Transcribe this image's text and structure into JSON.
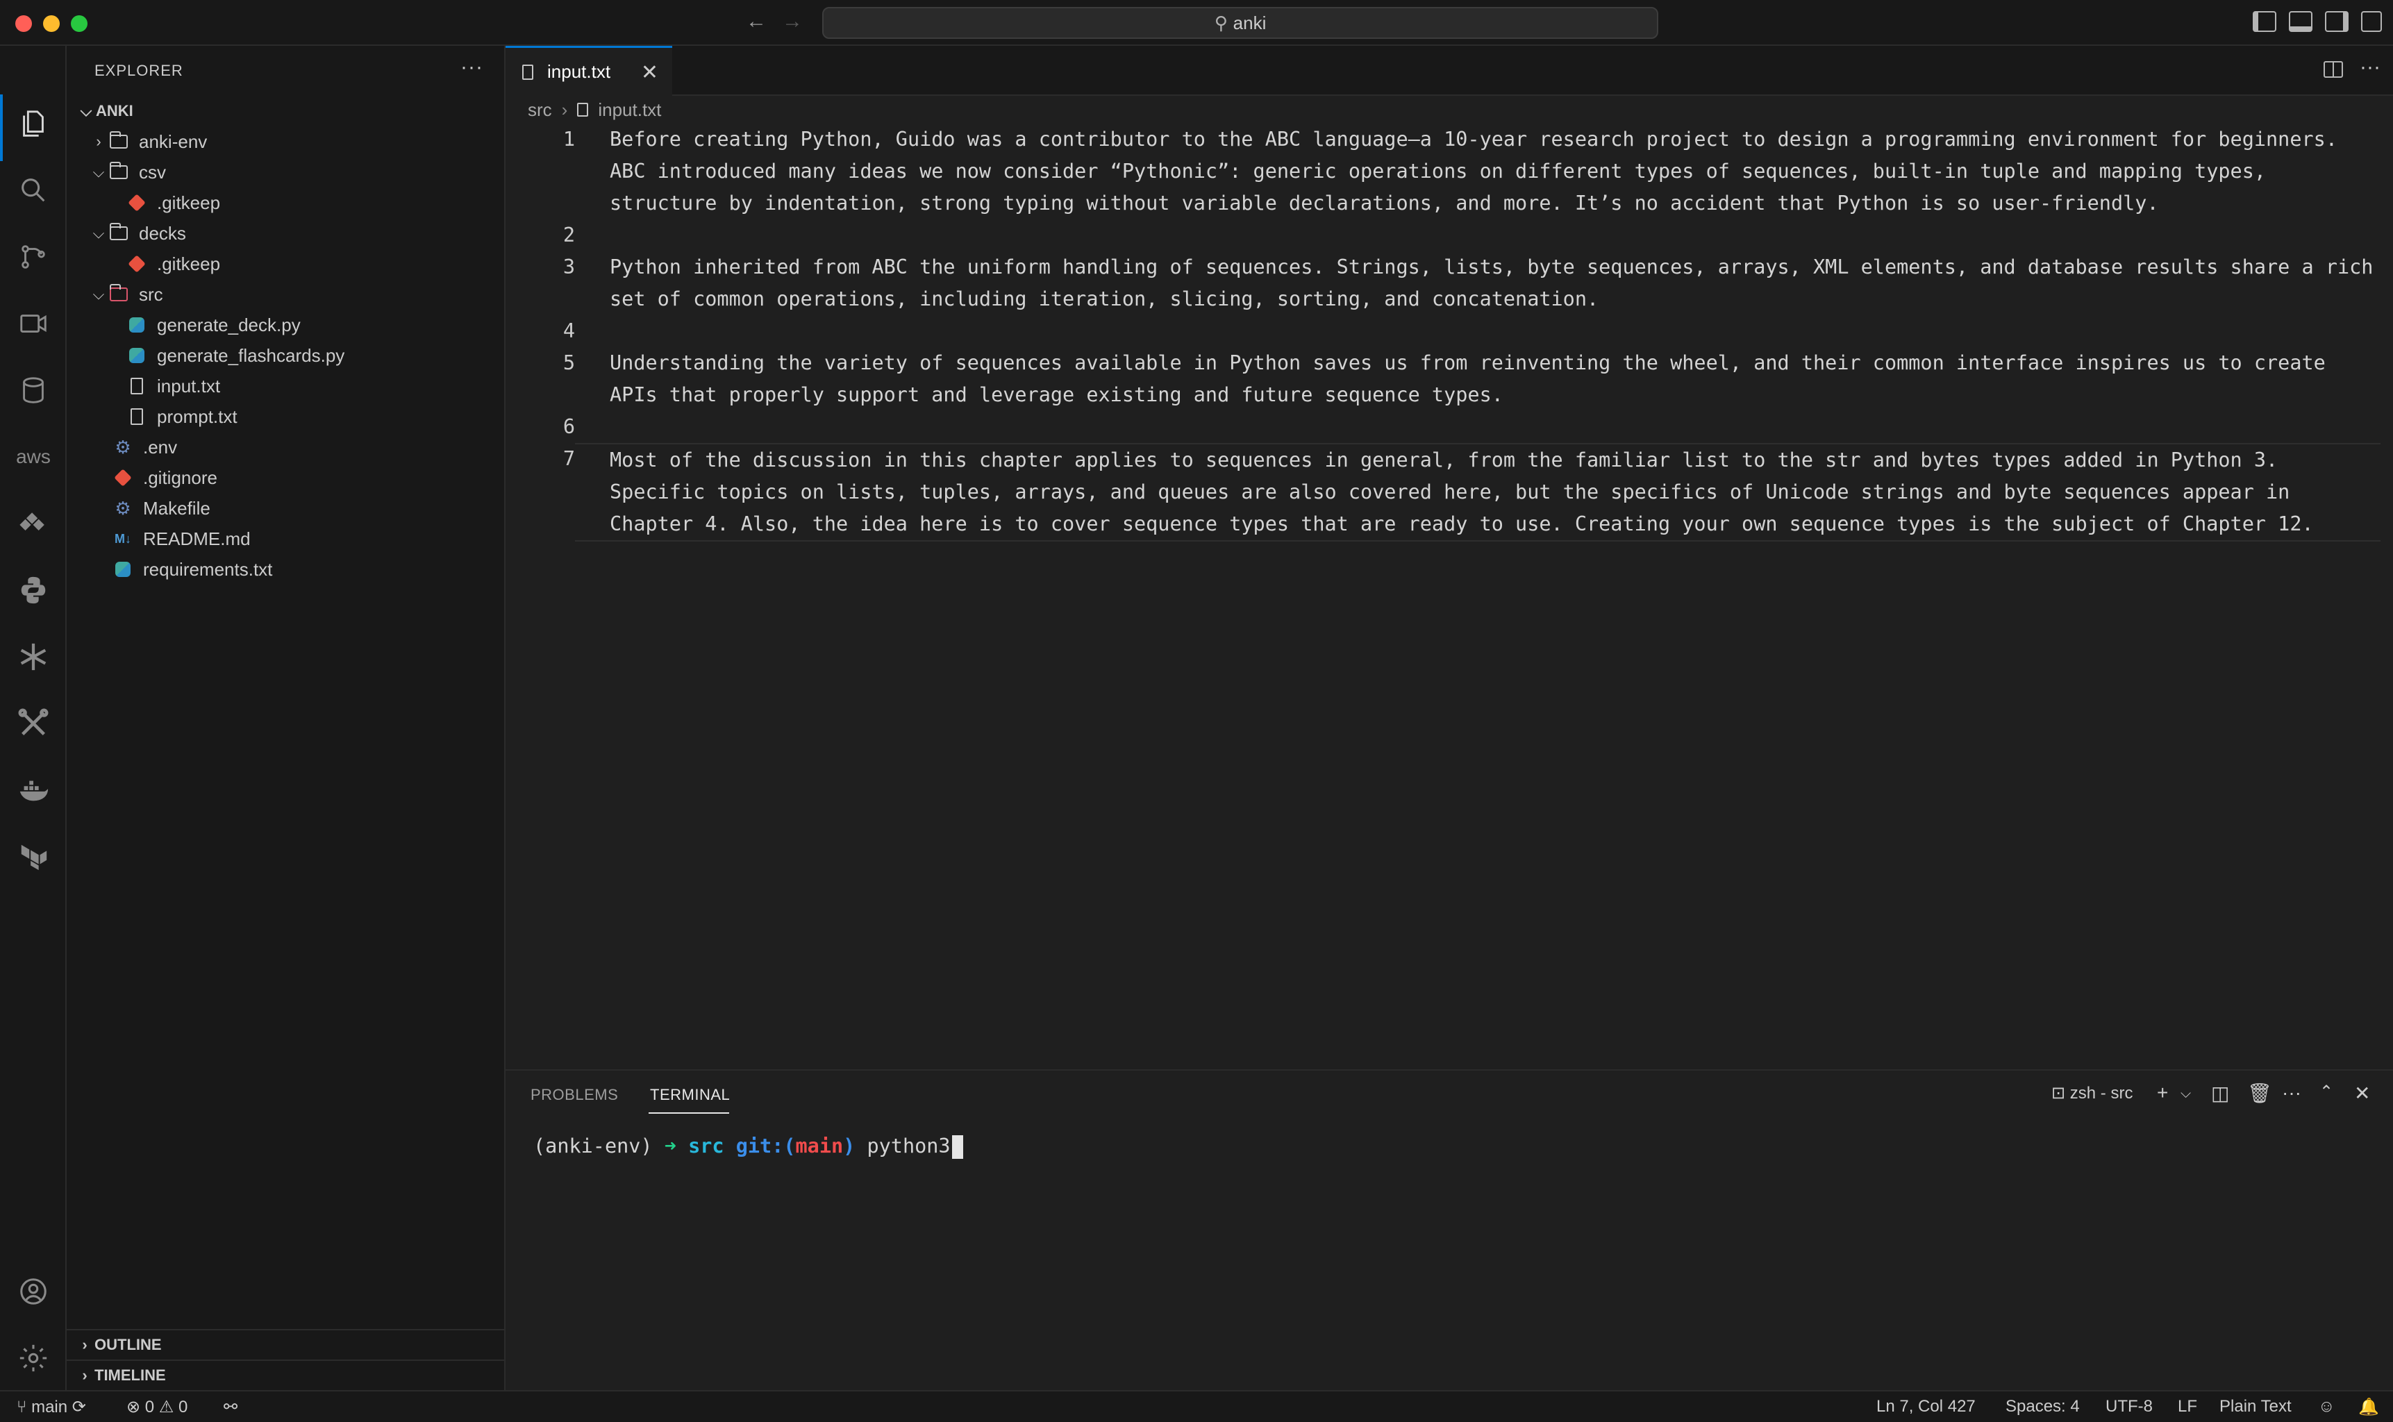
{
  "titlebar": {
    "search_text": "anki",
    "back_icon": "arrow-left-icon",
    "forward_icon": "arrow-right-icon"
  },
  "activity_bar": {
    "items": [
      "explorer-icon",
      "search-icon",
      "source-control-icon",
      "run-debug-icon",
      "database-icon",
      "aws-icon",
      "extensions-icon",
      "python-icon",
      "snowflake-icon",
      "tools-icon",
      "docker-icon",
      "terraform-icon"
    ],
    "aws_label": "aws",
    "bottom": [
      "account-icon",
      "settings-gear-icon"
    ]
  },
  "explorer": {
    "title": "EXPLORER",
    "more": "···",
    "root": "ANKI",
    "items": [
      {
        "label": "anki-env",
        "type": "folder",
        "expanded": false
      },
      {
        "label": "csv",
        "type": "folder",
        "expanded": true
      },
      {
        "label": ".gitkeep",
        "type": "git"
      },
      {
        "label": "decks",
        "type": "folder",
        "expanded": true
      },
      {
        "label": ".gitkeep",
        "type": "git"
      },
      {
        "label": "src",
        "type": "folder",
        "expanded": true
      },
      {
        "label": "generate_deck.py",
        "type": "python"
      },
      {
        "label": "generate_flashcards.py",
        "type": "python"
      },
      {
        "label": "input.txt",
        "type": "text"
      },
      {
        "label": "prompt.txt",
        "type": "text"
      },
      {
        "label": ".env",
        "type": "gear"
      },
      {
        "label": ".gitignore",
        "type": "git"
      },
      {
        "label": "Makefile",
        "type": "gear"
      },
      {
        "label": "README.md",
        "type": "markdown"
      },
      {
        "label": "requirements.txt",
        "type": "python"
      }
    ],
    "outline": "OUTLINE",
    "timeline": "TIMELINE"
  },
  "editor": {
    "tab_label": "input.txt",
    "close": "✕",
    "breadcrumb": [
      "src",
      "input.txt"
    ],
    "lines": [
      {
        "n": "1",
        "text": "Before creating Python, Guido was a contributor to the ABC language—a 10-year research project to design a programming environment for beginners. ABC introduced many ideas we now consider “Pythonic”: generic operations on different types of sequences, built-in tuple and mapping types, structure by indentation, strong typing without variable declarations, and more. It’s no accident that Python is so user-friendly."
      },
      {
        "n": "2",
        "text": ""
      },
      {
        "n": "3",
        "text": "Python inherited from ABC the uniform handling of sequences. Strings, lists, byte sequences, arrays, XML elements, and database results share a rich set of common operations, including iteration, slicing, sorting, and concatenation."
      },
      {
        "n": "4",
        "text": ""
      },
      {
        "n": "5",
        "text": "Understanding the variety of sequences available in Python saves us from reinventing the wheel, and their common interface inspires us to create APIs that properly support and leverage existing and future sequence types."
      },
      {
        "n": "6",
        "text": ""
      },
      {
        "n": "7",
        "text": "Most of the discussion in this chapter applies to sequences in general, from the familiar list to the str and bytes types added in Python 3. Specific topics on lists, tuples, arrays, and queues are also covered here, but the specifics of Unicode strings and byte sequences appear in Chapter 4. Also, the idea here is to cover sequence types that are ready to use. Creating your own sequence types is the subject of Chapter 12."
      }
    ]
  },
  "panel": {
    "tabs": [
      "PROBLEMS",
      "TERMINAL"
    ],
    "active_tab": "TERMINAL",
    "terminal_name": "zsh - src",
    "prompt": {
      "env": "(anki-env) ",
      "arrow": "➜ ",
      "dir": "src ",
      "git": "git:(",
      "branch": "main",
      "git_close": ")",
      "command": " python3"
    }
  },
  "statusbar": {
    "branch": "main",
    "errors": "0",
    "warnings": "0",
    "position": "Ln 7, Col 427",
    "spaces": "Spaces: 4",
    "encoding": "UTF-8",
    "eol": "LF",
    "language": "Plain Text"
  }
}
